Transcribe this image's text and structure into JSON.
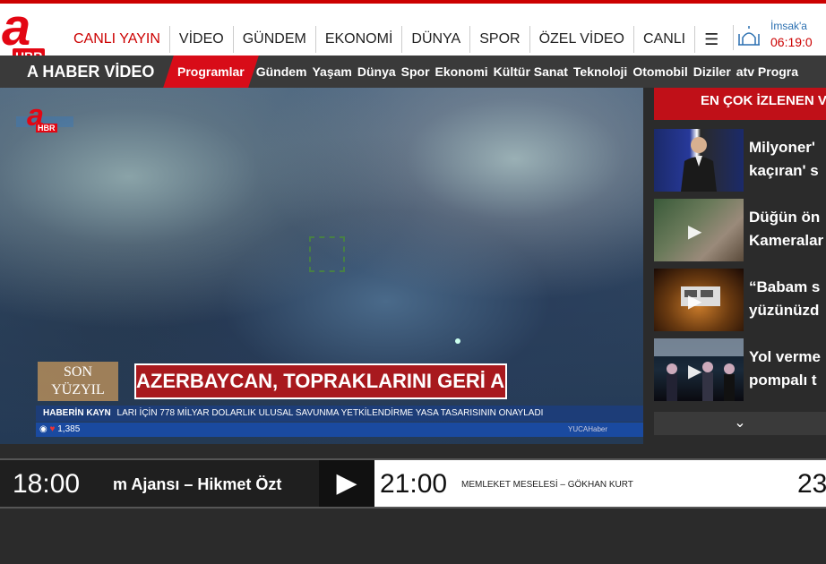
{
  "header": {
    "logo_letter": "a",
    "logo_badge": "HBR",
    "nav": [
      "CANLI YAYIN",
      "VİDEO",
      "GÜNDEM",
      "EKONOMİ",
      "DÜNYA",
      "SPOR",
      "ÖZEL VİDEO",
      "CANLI"
    ],
    "menu_icon": "hamburger-icon",
    "prayer_name": "İmsak'a",
    "prayer_time": "06:19:0"
  },
  "subnav": {
    "brand": "A HABER VİDEO",
    "categories": [
      "Programlar",
      "Gündem",
      "Yaşam",
      "Dünya",
      "Spor",
      "Ekonomi",
      "Kültür Sanat",
      "Teknoloji",
      "Otomobil",
      "Diziler",
      "atv Progra"
    ]
  },
  "video": {
    "watermark_letter": "a",
    "watermark_badge": "HBR",
    "show_logo_line1": "SON",
    "show_logo_line2": "YÜZYIL",
    "headline": "AZERBAYCAN, TOPRAKLARINI GERİ ALDI",
    "ticker_tag": "HABERİN KAYN",
    "ticker_text": "LARI İÇİN 778 MİLYAR DOLARLIK ULUSAL SAVUNMA YETKİLENDİRME YASA TASARISININ ONAYLADI",
    "views": "1,385",
    "copyright": "YUCAHaber"
  },
  "sidebar": {
    "title": "EN ÇOK İZLENEN V",
    "items": [
      {
        "line1": "Milyoner'",
        "line2": "kaçıran' s"
      },
      {
        "line1": "Düğün ön",
        "line2": "Kameralar"
      },
      {
        "line1": "“Babam s",
        "line2": "yüzünüzd"
      },
      {
        "line1": "Yol verme",
        "line2": "pompalı t"
      }
    ],
    "more_icon": "chevron-down-icon"
  },
  "schedule": {
    "current_time": "18:00",
    "current_program": "m Ajansı – Hikmet Özt",
    "next_time": "21:00",
    "next_program": "MEMLEKET MESELESİ – GÖKHAN KURT",
    "later_time": "23"
  }
}
